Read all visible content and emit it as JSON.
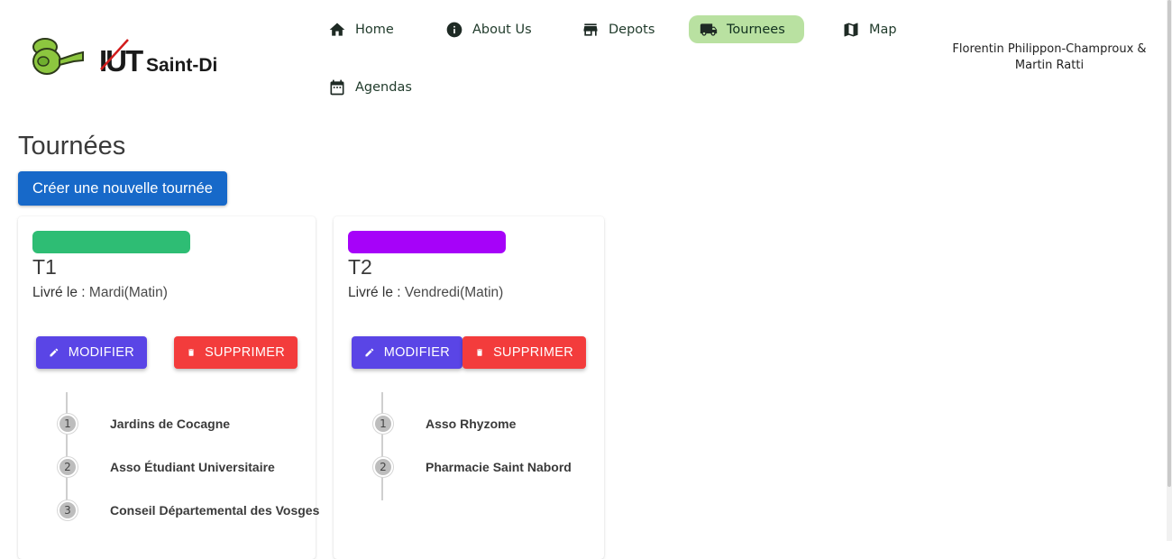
{
  "header": {
    "logo_text": "IUT Saint-Dié",
    "authors_line1": "Florentin Philippon-Champroux &",
    "authors_line2": "Martin Ratti",
    "nav": [
      {
        "label": "Home",
        "icon": "home-icon",
        "active": false
      },
      {
        "label": "About Us",
        "icon": "info-icon",
        "active": false
      },
      {
        "label": "Depots",
        "icon": "store-icon",
        "active": false
      },
      {
        "label": "Tournees",
        "icon": "truck-icon",
        "active": true
      },
      {
        "label": "Map",
        "icon": "map-icon",
        "active": false
      },
      {
        "label": "Agendas",
        "icon": "calendar-icon",
        "active": false
      }
    ]
  },
  "page": {
    "title": "Tournées",
    "create_button": "Créer une nouvelle tournée"
  },
  "tours": [
    {
      "name": "T1",
      "color": "#2ebd74",
      "delivery_label": "Livré le :",
      "delivery_value": "Mardi(Matin)",
      "edit_label": "MODIFIER",
      "delete_label": "SUPPRIMER",
      "stops": [
        {
          "num": "1",
          "name": "Jardins de Cocagne"
        },
        {
          "num": "2",
          "name": "Asso Étudiant Universitaire"
        },
        {
          "num": "3",
          "name": "Conseil Départemental des Vosges"
        }
      ]
    },
    {
      "name": "T2",
      "color": "#a602f9",
      "delivery_label": "Livré le :",
      "delivery_value": "Vendredi(Matin)",
      "edit_label": "MODIFIER",
      "delete_label": "SUPPRIMER",
      "stops": [
        {
          "num": "1",
          "name": "Asso Rhyzome"
        },
        {
          "num": "2",
          "name": "Pharmacie Saint Nabord"
        }
      ]
    }
  ],
  "colors": {
    "active_nav_bg": "#b9e1a1",
    "primary_button": "#1769c9",
    "edit_button": "#5a45e6",
    "delete_button": "#f33c3c"
  }
}
